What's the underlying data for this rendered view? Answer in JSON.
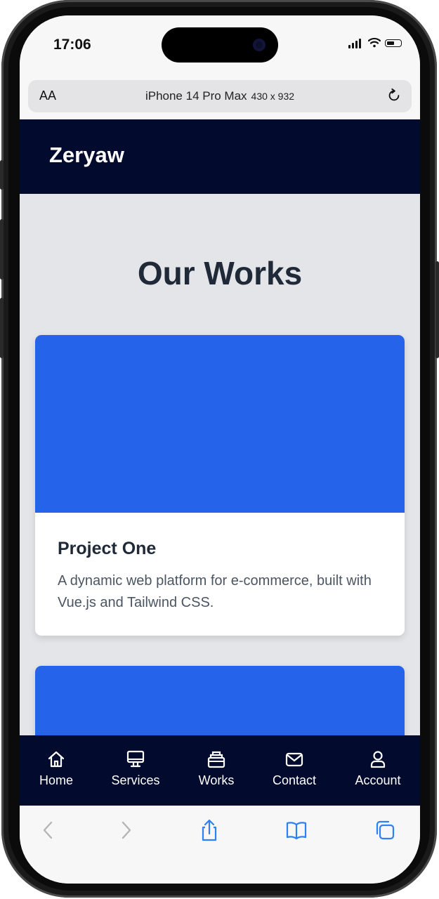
{
  "status_bar": {
    "time": "17:06"
  },
  "browser": {
    "text_size_label": "AA",
    "device_label": "iPhone 14 Pro Max",
    "device_dims": "430 x 932"
  },
  "header": {
    "brand": "Zeryaw"
  },
  "main": {
    "title": "Our Works",
    "projects": [
      {
        "title": "Project One",
        "description": "A dynamic web platform for e-commerce, built with Vue.js and Tailwind CSS.",
        "image_color": "#2563eb"
      },
      {
        "image_color": "#2563eb"
      }
    ]
  },
  "bottom_nav": {
    "items": [
      {
        "label": "Home",
        "icon": "home-icon"
      },
      {
        "label": "Services",
        "icon": "monitor-icon"
      },
      {
        "label": "Works",
        "icon": "briefcase-icon"
      },
      {
        "label": "Contact",
        "icon": "mail-icon"
      },
      {
        "label": "Account",
        "icon": "user-icon"
      }
    ]
  },
  "toolbar": {
    "icons": [
      "back-icon",
      "forward-icon",
      "share-icon",
      "bookmarks-icon",
      "tabs-icon"
    ]
  },
  "colors": {
    "header_bg": "#020a2e",
    "accent_blue": "#2563eb",
    "page_bg": "#e4e5e8",
    "toolbar_blue": "#2f7ff5"
  }
}
